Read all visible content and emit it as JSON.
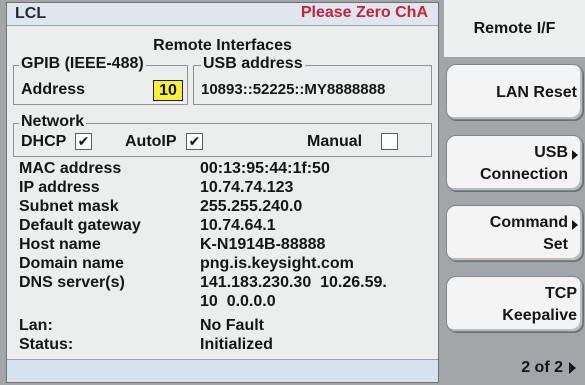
{
  "status": {
    "mode": "LCL",
    "message": "Please Zero ChA"
  },
  "title": "Remote Interfaces",
  "gpib": {
    "legend": "GPIB (IEEE-488)",
    "address_label": "Address",
    "address_value": "10"
  },
  "usb": {
    "legend": "USB address",
    "value": "10893::52225::MY8888888"
  },
  "network": {
    "legend": "Network",
    "dhcp_label": "DHCP",
    "dhcp_checked": true,
    "autoip_label": "AutoIP",
    "autoip_checked": true,
    "manual_label": "Manual",
    "manual_checked": false
  },
  "details": [
    {
      "label": "MAC address",
      "value": "00:13:95:44:1f:50"
    },
    {
      "label": "IP address",
      "value": "10.74.74.123"
    },
    {
      "label": "Subnet mask",
      "value": "255.255.240.0"
    },
    {
      "label": "Default gateway",
      "value": "10.74.64.1"
    },
    {
      "label": "Host name",
      "value": "K-N1914B-88888"
    },
    {
      "label": "Domain name",
      "value": "png.is.keysight.com"
    },
    {
      "label": "DNS server(s)",
      "value": "141.183.230.30  10.26.59."
    },
    {
      "label": "",
      "value": "10  0.0.0.0"
    },
    {
      "label": "Lan:",
      "value": "No Fault"
    },
    {
      "label": "Status:",
      "value": "Initialized"
    }
  ],
  "softkeys": {
    "title": "Remote I/F",
    "lan_reset": "LAN Reset",
    "usb_line1": "USB",
    "usb_line2": "Connection",
    "cmd_line1": "Command",
    "cmd_line2": "Set",
    "tcp_line1": "TCP",
    "tcp_line2": "Keepalive",
    "page": "2 of 2"
  },
  "check_mark": "✔"
}
